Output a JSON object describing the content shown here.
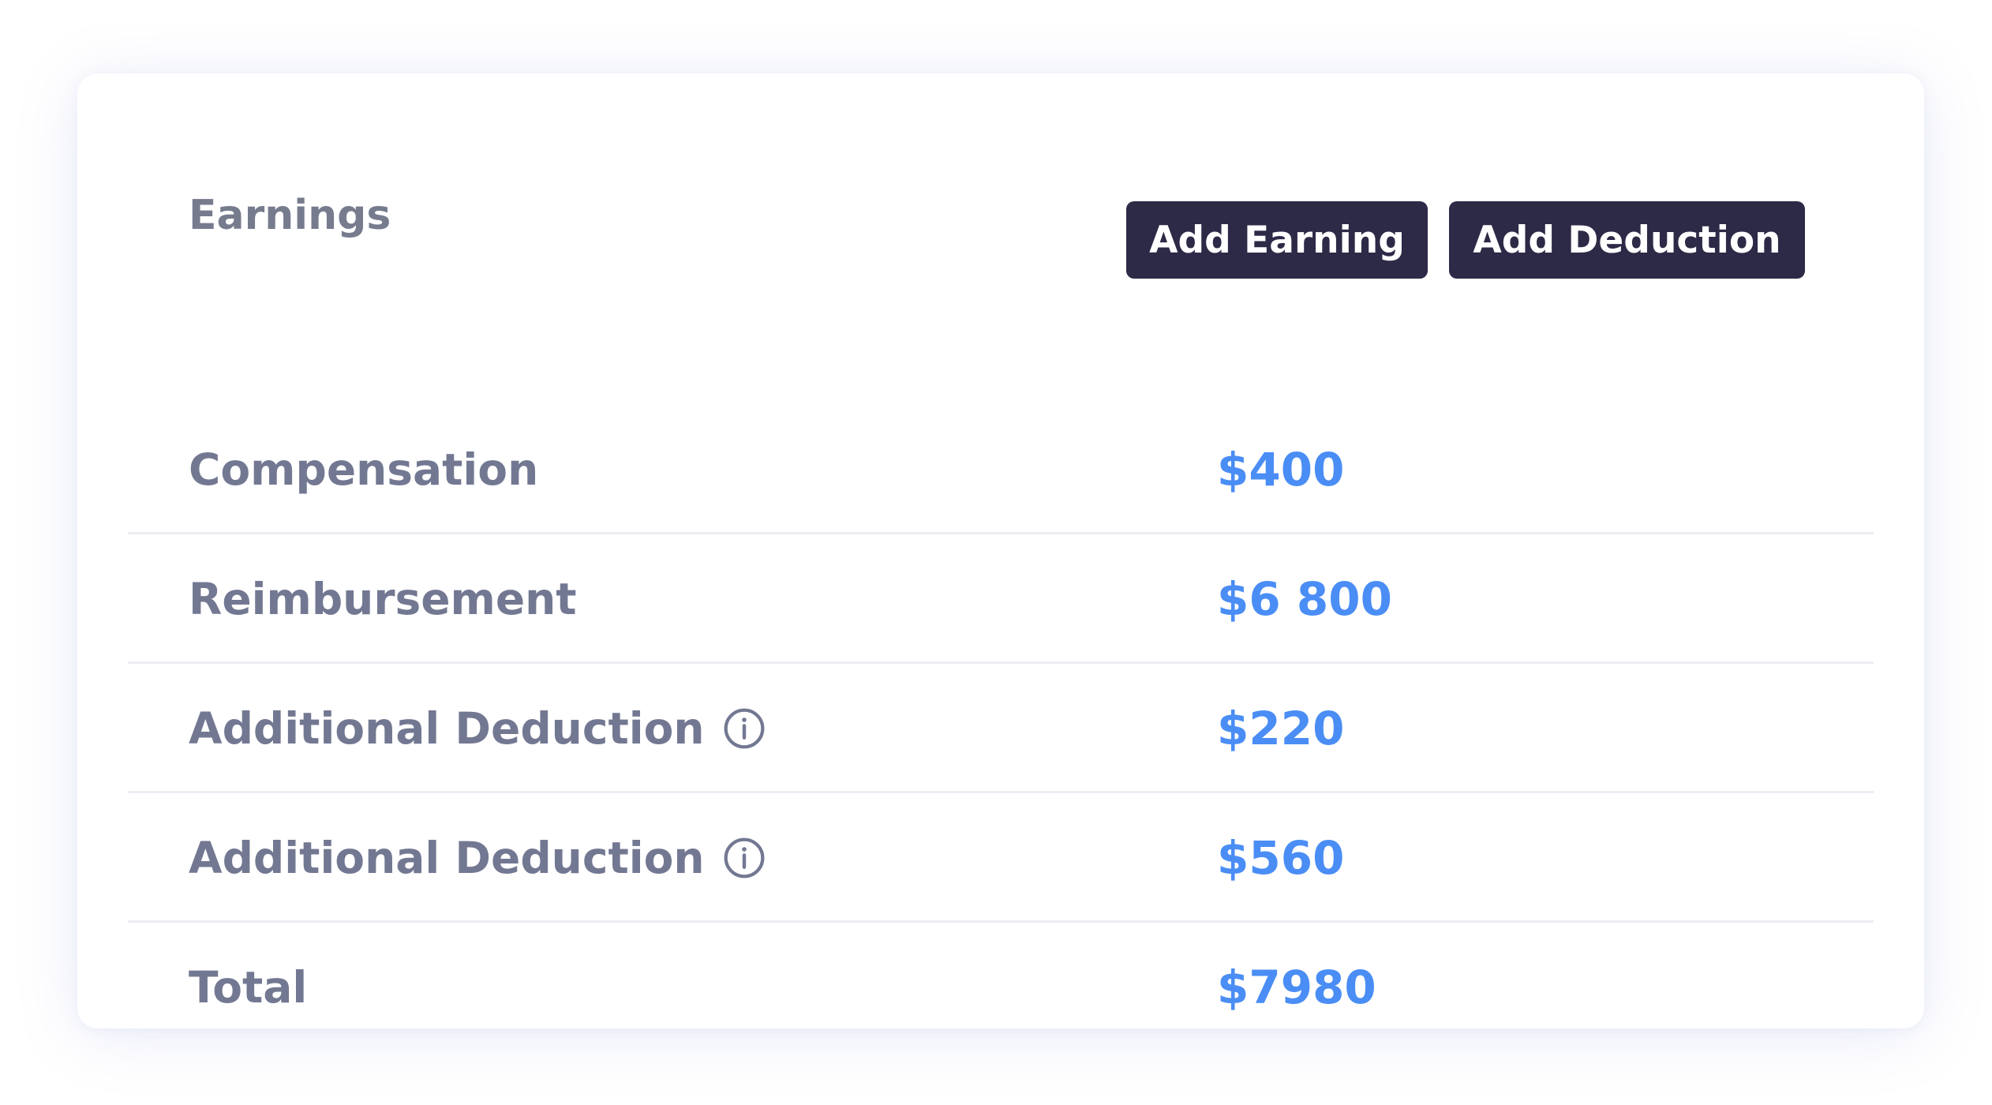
{
  "earnings": {
    "title": "Earnings",
    "buttons": {
      "add_earning": "Add Earning",
      "add_deduction": "Add Deduction"
    },
    "rows": [
      {
        "label": "Compensation",
        "amount": "$400"
      },
      {
        "label": "Reimbursement",
        "amount": "$6 800"
      },
      {
        "label": "Additional Deduction",
        "amount": "$220",
        "icon": "info-icon"
      },
      {
        "label": "Additional Deduction",
        "amount": "$560",
        "icon": "info-icon"
      },
      {
        "label": "Total",
        "amount": "$7980"
      }
    ]
  },
  "colors": {
    "button_bg": "#2c2a46",
    "amount": "#4a8df5",
    "label": "#737892",
    "divider": "#eceef4"
  }
}
